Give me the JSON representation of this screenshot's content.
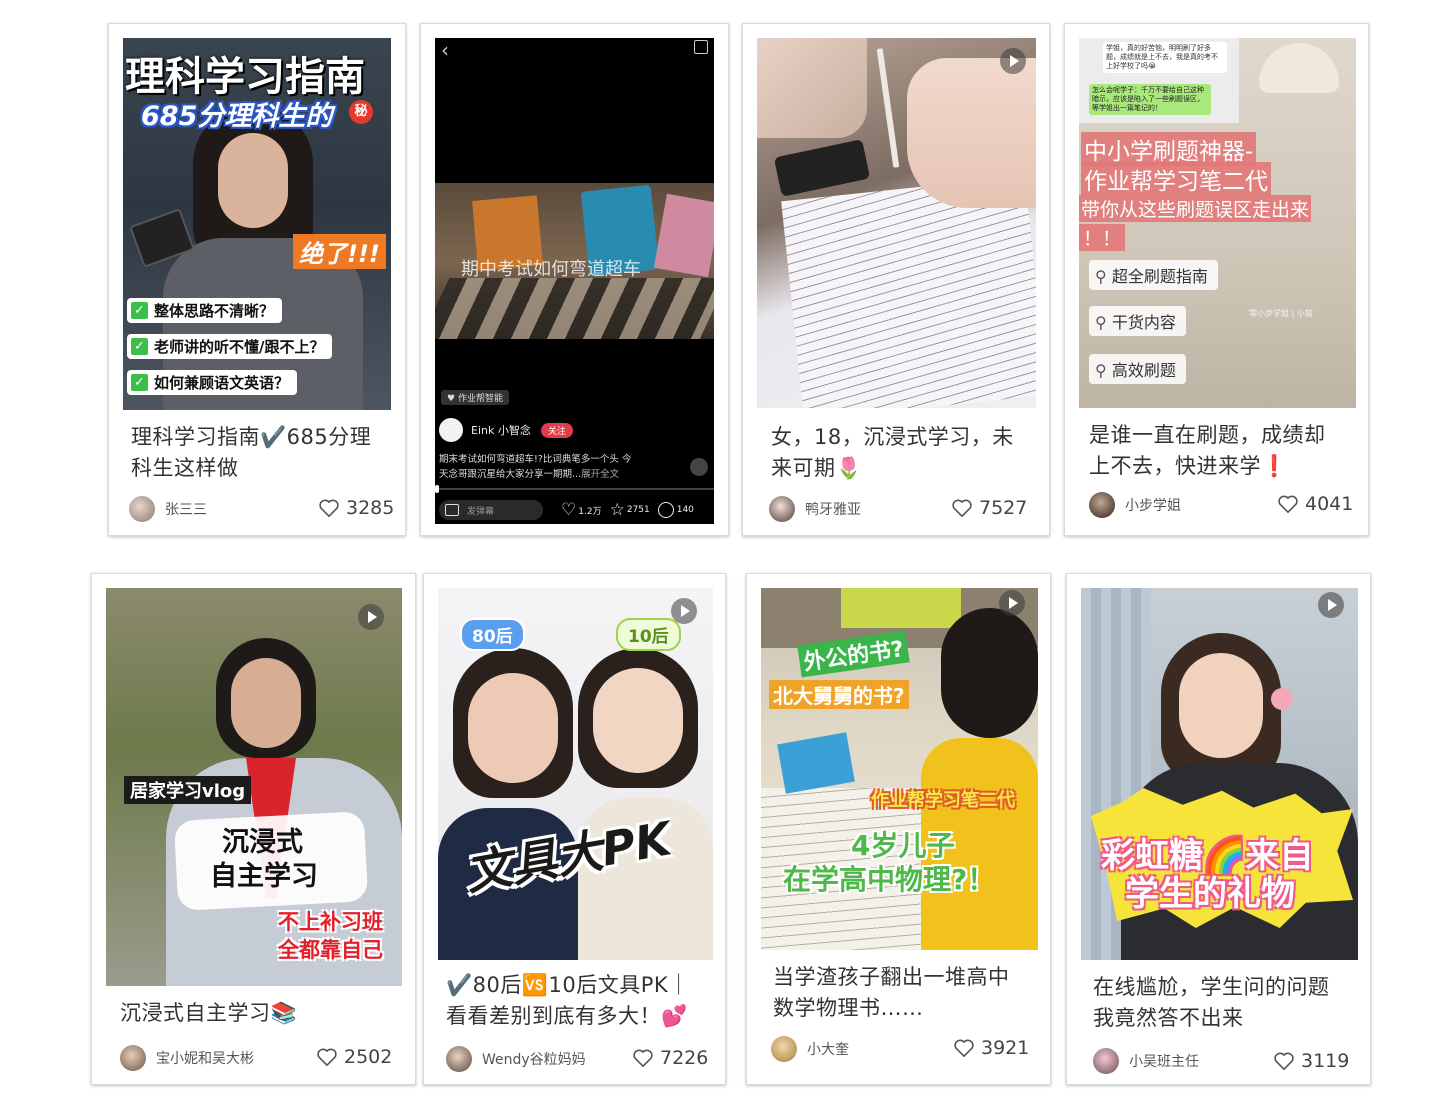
{
  "cards": [
    {
      "title_line1": "理科学习指南✔️685分理",
      "title_line2": "科生这样做",
      "author": "张三三",
      "likes": "3285",
      "overlay": {
        "headline": "理科学习指南",
        "subhead": "685分理科生的",
        "seal": "秘",
        "wow": "绝了!!!",
        "checks": [
          "整体思路不清晰？",
          "老师讲的听不懂/跟不上？",
          "如何兼顾语文英语？"
        ]
      }
    },
    {
      "overlay": {
        "video_caption": "期中考试如何弯道超车",
        "brand": "作业帮智能",
        "channel": "Eink 小智念",
        "follow": "关注",
        "desc_line1": "期末考试如何弯道超车!?比词典笔多一个头 今",
        "desc_line2": "天念哥跟沉星给大家分享一期期...",
        "expand": "展开全文",
        "comment_placeholder": "发弹幕",
        "like_count": "1.2万",
        "star_count": "2751",
        "comment_count": "140"
      }
    },
    {
      "title_line1": "女，18，沉浸式学习，未",
      "title_line2": "来可期🌷",
      "author": "鸭牙雅亚",
      "likes": "7527"
    },
    {
      "title_line1": "是谁一直在刷题，成绩却",
      "title_line2": "上不去，快进来学❗",
      "author": "小步学姐",
      "likes": "4041",
      "overlay": {
        "chat1": "学姐，真的好苦恼，明明刷了好多题，成绩就是上不去，我是真的考不上好学校了吗😭",
        "chat2": "怎么会呢学子：千万不要给自己这种暗示，应该是陷入了一些刷题误区，等学姐出一篇笔记的！",
        "line1": "中小学刷题神器-",
        "line2": "作业帮学习笔二代",
        "line3": "带你从这些刷题误区走出来",
        "line4": "！！",
        "pins": [
          "超全刷题指南",
          "干货内容",
          "高效刷题"
        ],
        "watermark": "零小步学姐 | 小猫"
      }
    },
    {
      "title_line1": "沉浸式自主学习📚",
      "author": "宝小妮和吴大彬",
      "likes": "2502",
      "overlay": {
        "tag": "居家学习vlog",
        "big1": "沉浸式",
        "big2": "自主学习",
        "red1": "不上补习班",
        "red2": "全都靠自己"
      }
    },
    {
      "title_line1": "✔️80后🆚10后文具PK｜",
      "title_line2": "看看差别到底有多大！💕",
      "author": "Wendy谷粒妈妈",
      "likes": "7226",
      "overlay": {
        "left_bubble": "80后",
        "right_bubble": "10后",
        "big": "文具大PK"
      }
    },
    {
      "title_line1": "当学渣孩子翻出一堆高中",
      "title_line2": "数学物理书……",
      "author": "小大奎",
      "likes": "3921",
      "overlay": {
        "q1": "外公的书?",
        "q2": "北大舅舅的书?",
        "brand": "作业帮学习笔二代",
        "big1": "4岁儿子",
        "big2": "在学高中物理?！"
      }
    },
    {
      "title_line1": "在线尴尬，学生问的问题",
      "title_line2": "我竟然答不出来",
      "author": "小吴班主任",
      "likes": "3119",
      "overlay": {
        "big1": "彩虹糖🌈来自",
        "big2": "学生的礼物"
      }
    }
  ]
}
